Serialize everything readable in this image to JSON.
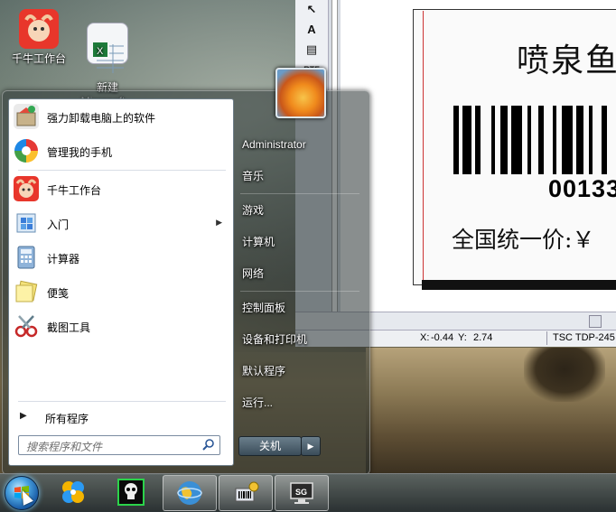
{
  "desktop": {
    "icons": [
      {
        "label": "千牛工作台",
        "icon": "qianniu-icon"
      },
      {
        "label": "新建\nMicrosoft...",
        "icon": "excel-file-icon"
      }
    ]
  },
  "label_editor": {
    "toolbar": [
      "A",
      "RTF"
    ],
    "label": {
      "title": "喷泉鱼",
      "barcode_number": "00133",
      "price": "全国统一价:￥"
    },
    "status": {
      "x_label": "X:",
      "x_value": "-0.44",
      "y_label": "Y:",
      "y_value": "2.74",
      "printer": "TSC TDP-245"
    }
  },
  "start_menu": {
    "programs": [
      {
        "label": "强力卸载电脑上的软件",
        "icon": "uninstall-icon"
      },
      {
        "label": "管理我的手机",
        "icon": "phone-manager-icon"
      },
      {
        "label": "千牛工作台",
        "icon": "qianniu-icon"
      },
      {
        "label": "入门",
        "icon": "getting-started-icon",
        "has_submenu": true
      },
      {
        "label": "计算器",
        "icon": "calculator-icon"
      },
      {
        "label": "便笺",
        "icon": "sticky-notes-icon"
      },
      {
        "label": "截图工具",
        "icon": "snipping-tool-icon"
      }
    ],
    "all_programs": "所有程序",
    "search_placeholder": "搜索程序和文件",
    "right_items": [
      "Administrator",
      "音乐",
      "游戏",
      "计算机",
      "网络",
      "控制面板",
      "设备和打印机",
      "默认程序",
      "运行..."
    ],
    "shutdown_label": "关机"
  },
  "taskbar": {
    "buttons": [
      "start-orb",
      "pinned-app-1",
      "pinned-app-2",
      "pinned-app-3",
      "pinned-app-4",
      "pinned-app-5"
    ]
  },
  "colors": {
    "accent": "#1b5ea8",
    "start_menu_glass": "#2f3b3e"
  }
}
